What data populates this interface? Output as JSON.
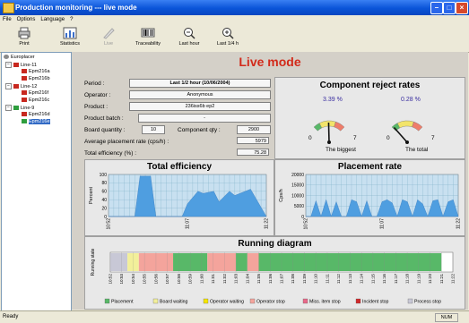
{
  "window": {
    "title": "Production monitoring --- live mode"
  },
  "menu": [
    "File",
    "Options",
    "Language",
    "?"
  ],
  "toolbar": [
    {
      "label": "Print",
      "icon": "printer-icon",
      "enabled": true
    },
    {
      "label": "Statistics",
      "icon": "statistics-icon",
      "enabled": true
    },
    {
      "label": "Live",
      "icon": "live-icon",
      "enabled": false
    },
    {
      "label": "Traceability",
      "icon": "traceability-icon",
      "enabled": true
    },
    {
      "label": "Last hour",
      "icon": "zoom-out-icon",
      "enabled": true
    },
    {
      "label": "Last 1/4 h",
      "icon": "zoom-in-icon",
      "enabled": true
    }
  ],
  "tree": {
    "root": "Europlacer",
    "lines": [
      {
        "name": "Line-11",
        "machines": [
          "Epm216a",
          "Epm216b"
        ]
      },
      {
        "name": "Line-12",
        "machines": [
          "Epm216f",
          "Epm216c"
        ]
      },
      {
        "name": "Line-9",
        "machines": [
          "Epm216d",
          "Epm216e"
        ]
      }
    ],
    "selected": "Epm216e"
  },
  "main": {
    "title": "Live mode",
    "fields": {
      "period_label": "Period :",
      "period_value": "Last 1/2 hour (10/06/2004)",
      "operator_label": "Operator :",
      "operator_value": "Anonymous",
      "product_label": "Product :",
      "product_value": "236iss6b ep2",
      "batch_label": "Product batch :",
      "batch_value": "-",
      "boardqty_label": "Board quantity :",
      "boardqty_value": "10",
      "compqty_label": "Component qty :",
      "compqty_value": "2900",
      "avgrate_label": "Average placement rate (cps/h) :",
      "avgrate_value": "5979",
      "efficiency_label": "Total efficiency (%) :",
      "efficiency_value": "75.28"
    },
    "reject": {
      "title": "Component reject rates",
      "gauges": [
        {
          "pct_label": "3.39 %",
          "value": 3.39,
          "min": "0",
          "max": "7",
          "caption": "The biggest"
        },
        {
          "pct_label": "0.28 %",
          "value": 0.28,
          "min": "0",
          "max": "7",
          "caption": "The total"
        }
      ]
    }
  },
  "colors": {
    "plot_area": "#c8e0f0",
    "series": "#4f9ee0",
    "legend": [
      "#58b868",
      "#f2ef9a",
      "#f5e600",
      "#f4a49c",
      "#e86a8a",
      "#d0282a",
      "#c8c8d6"
    ]
  },
  "chart_data": [
    {
      "type": "area",
      "title": "Total efficiency",
      "ylabel": "Percent",
      "ylim": [
        0,
        100
      ],
      "yticks": [
        0,
        20,
        40,
        60,
        80,
        100
      ],
      "xlim": [
        0,
        30
      ],
      "xticks": [
        "10:52",
        "11:07",
        "11:22"
      ],
      "x": [
        0,
        3,
        5,
        6,
        8,
        9,
        11,
        12,
        14,
        15,
        17,
        18,
        20,
        21,
        23,
        24,
        26,
        27,
        30
      ],
      "y": [
        0,
        0,
        0,
        96,
        96,
        0,
        0,
        0,
        0,
        30,
        60,
        55,
        60,
        35,
        60,
        50,
        60,
        65,
        0
      ]
    },
    {
      "type": "area",
      "title": "Placement rate",
      "ylabel": "Cps/h",
      "ylim": [
        0,
        20000
      ],
      "yticks": [
        0,
        5000,
        10000,
        15000,
        20000
      ],
      "xlim": [
        0,
        30
      ],
      "xticks": [
        "10:52",
        "11:07",
        "11:22"
      ],
      "x": [
        0,
        1,
        2,
        3,
        4,
        5,
        6,
        7,
        8,
        9,
        10,
        11,
        12,
        13,
        14,
        15,
        16,
        17,
        18,
        19,
        20,
        21,
        22,
        23,
        24,
        25,
        26,
        27,
        28,
        29,
        30
      ],
      "y": [
        0,
        0,
        7500,
        0,
        8000,
        0,
        7000,
        0,
        0,
        8000,
        7000,
        0,
        7500,
        0,
        0,
        7000,
        8000,
        6500,
        0,
        8000,
        7000,
        0,
        8000,
        6000,
        0,
        7500,
        8000,
        0,
        7000,
        8000,
        0
      ]
    },
    {
      "type": "timeline",
      "title": "Running diagram",
      "ylabel": "Running state",
      "xlim": [
        0,
        30
      ],
      "xticks": [
        "10:52",
        "10:53",
        "10:54",
        "10:55",
        "10:56",
        "10:57",
        "10:58",
        "10:59",
        "11:00",
        "11:01",
        "11:02",
        "11:03",
        "11:04",
        "11:05",
        "11:06",
        "11:07",
        "11:08",
        "11:09",
        "11:10",
        "11:11",
        "11:12",
        "11:13",
        "11:14",
        "11:15",
        "11:16",
        "11:17",
        "11:18",
        "11:19",
        "11:20",
        "11:21",
        "11:22"
      ],
      "segments": [
        {
          "start": 0,
          "end": 1.5,
          "state": "Process stop",
          "color": "#c8c8d6"
        },
        {
          "start": 1.5,
          "end": 2.5,
          "state": "Board waiting",
          "color": "#f2ef9a"
        },
        {
          "start": 2.5,
          "end": 5.5,
          "state": "Operator stop",
          "color": "#f4a49c"
        },
        {
          "start": 5.5,
          "end": 8.5,
          "state": "Placement",
          "color": "#58b868"
        },
        {
          "start": 8.5,
          "end": 11,
          "state": "Operator stop",
          "color": "#f4a49c"
        },
        {
          "start": 11,
          "end": 12,
          "state": "Placement",
          "color": "#58b868"
        },
        {
          "start": 12,
          "end": 13,
          "state": "Operator stop",
          "color": "#f4a49c"
        },
        {
          "start": 13,
          "end": 29,
          "state": "Placement",
          "color": "#58b868"
        }
      ],
      "legend": [
        "Placement",
        "Board waiting",
        "Operator waiting",
        "Operator stop",
        "Miss. item stop",
        "Incident stop",
        "Process stop"
      ]
    }
  ],
  "status": {
    "text": "Ready",
    "num": "NUM"
  }
}
